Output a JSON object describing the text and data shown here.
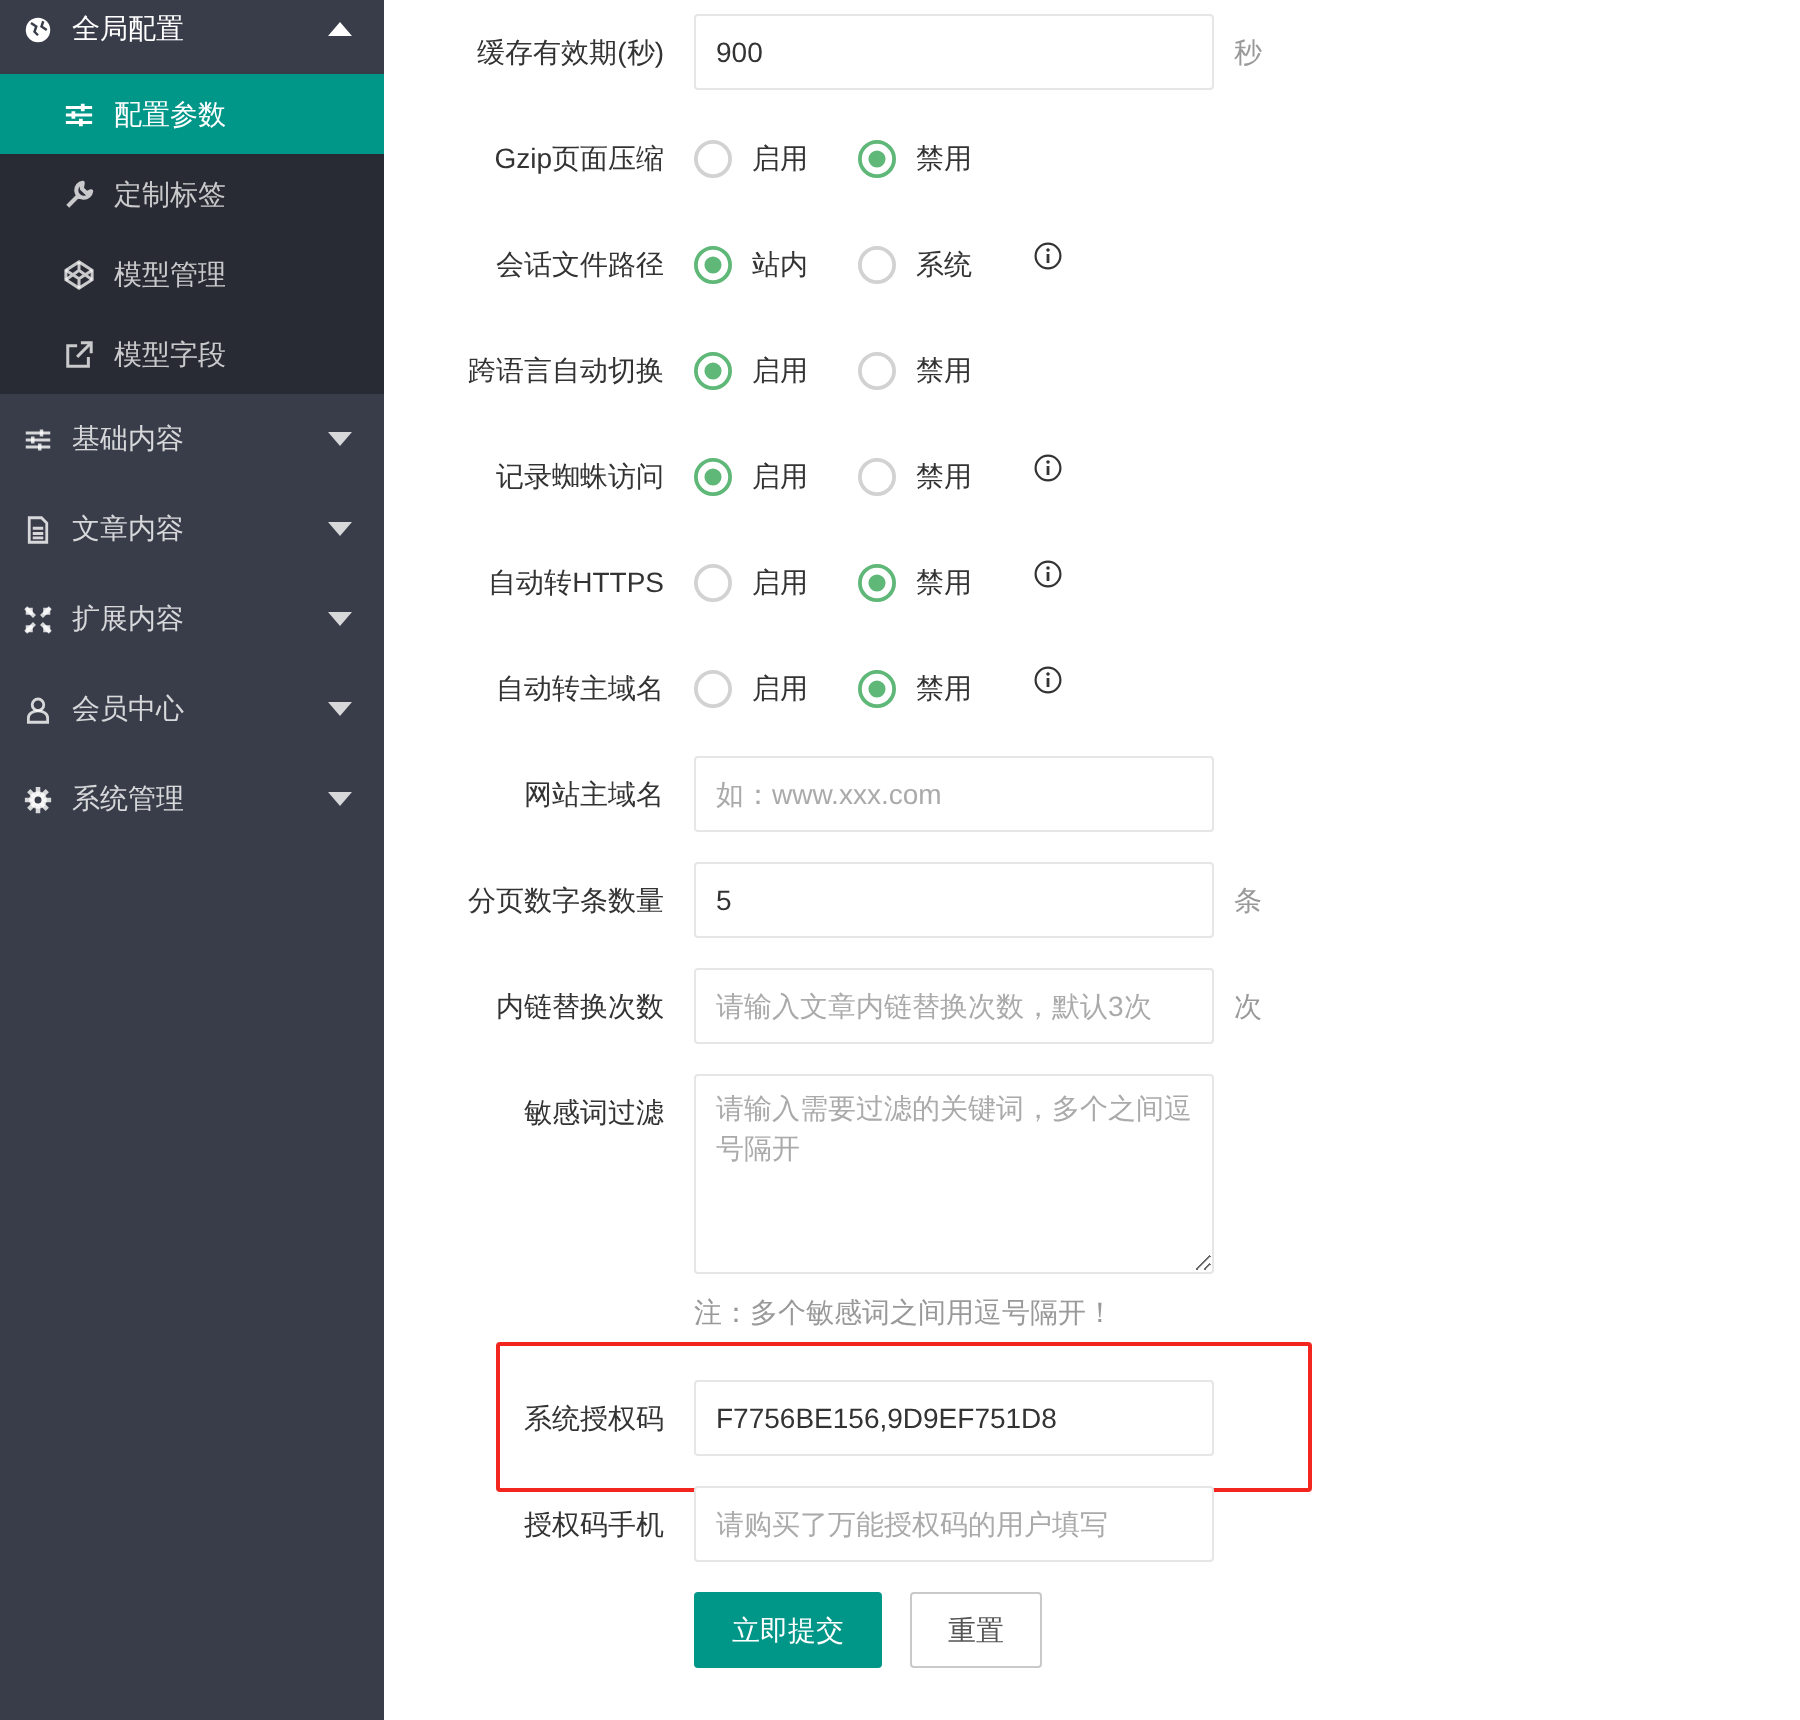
{
  "sidebar": {
    "groups": [
      {
        "label": "全局配置",
        "expanded": true,
        "children": [
          {
            "label": "配置参数",
            "selected": true
          },
          {
            "label": "定制标签",
            "selected": false
          },
          {
            "label": "模型管理",
            "selected": false
          },
          {
            "label": "模型字段",
            "selected": false
          }
        ]
      },
      {
        "label": "基础内容",
        "expanded": false
      },
      {
        "label": "文章内容",
        "expanded": false
      },
      {
        "label": "扩展内容",
        "expanded": false
      },
      {
        "label": "会员中心",
        "expanded": false
      },
      {
        "label": "系统管理",
        "expanded": false
      }
    ]
  },
  "form": {
    "fields": [
      {
        "kind": "text",
        "label": "缓存有效期(秒)",
        "value": "900",
        "suffix": "秒"
      },
      {
        "kind": "radio",
        "label": "Gzip页面压缩",
        "options": [
          {
            "label": "启用",
            "selected": false
          },
          {
            "label": "禁用",
            "selected": true
          }
        ]
      },
      {
        "kind": "radio",
        "label": "会话文件路径",
        "options": [
          {
            "label": "站内",
            "selected": true
          },
          {
            "label": "系统",
            "selected": false
          }
        ],
        "info": true
      },
      {
        "kind": "radio",
        "label": "跨语言自动切换",
        "options": [
          {
            "label": "启用",
            "selected": true
          },
          {
            "label": "禁用",
            "selected": false
          }
        ]
      },
      {
        "kind": "radio",
        "label": "记录蜘蛛访问",
        "options": [
          {
            "label": "启用",
            "selected": true
          },
          {
            "label": "禁用",
            "selected": false
          }
        ],
        "info": true
      },
      {
        "kind": "radio",
        "label": "自动转HTTPS",
        "options": [
          {
            "label": "启用",
            "selected": false
          },
          {
            "label": "禁用",
            "selected": true
          }
        ],
        "info": true
      },
      {
        "kind": "radio",
        "label": "自动转主域名",
        "options": [
          {
            "label": "启用",
            "selected": false
          },
          {
            "label": "禁用",
            "selected": true
          }
        ],
        "info": true
      },
      {
        "kind": "text",
        "label": "网站主域名",
        "placeholder": "如：www.xxx.com"
      },
      {
        "kind": "text",
        "label": "分页数字条数量",
        "value": "5",
        "suffix": "条"
      },
      {
        "kind": "text",
        "label": "内链替换次数",
        "placeholder": "请输入文章内链替换次数，默认3次",
        "suffix": "次"
      },
      {
        "kind": "textarea",
        "label": "敏感词过滤",
        "placeholder": "请输入需要过滤的关键词，多个之间逗号隔开",
        "note": "注：多个敏感词之间用逗号隔开！"
      },
      {
        "kind": "text",
        "label": "系统授权码",
        "value": "F7756BE156,9D9EF751D8",
        "highlighted": true
      },
      {
        "kind": "text",
        "label": "授权码手机",
        "placeholder": "请购买了万能授权码的用户填写"
      }
    ],
    "buttons": [
      {
        "label": "立即提交",
        "kind": "primary"
      },
      {
        "label": "重置",
        "kind": "default"
      }
    ]
  }
}
